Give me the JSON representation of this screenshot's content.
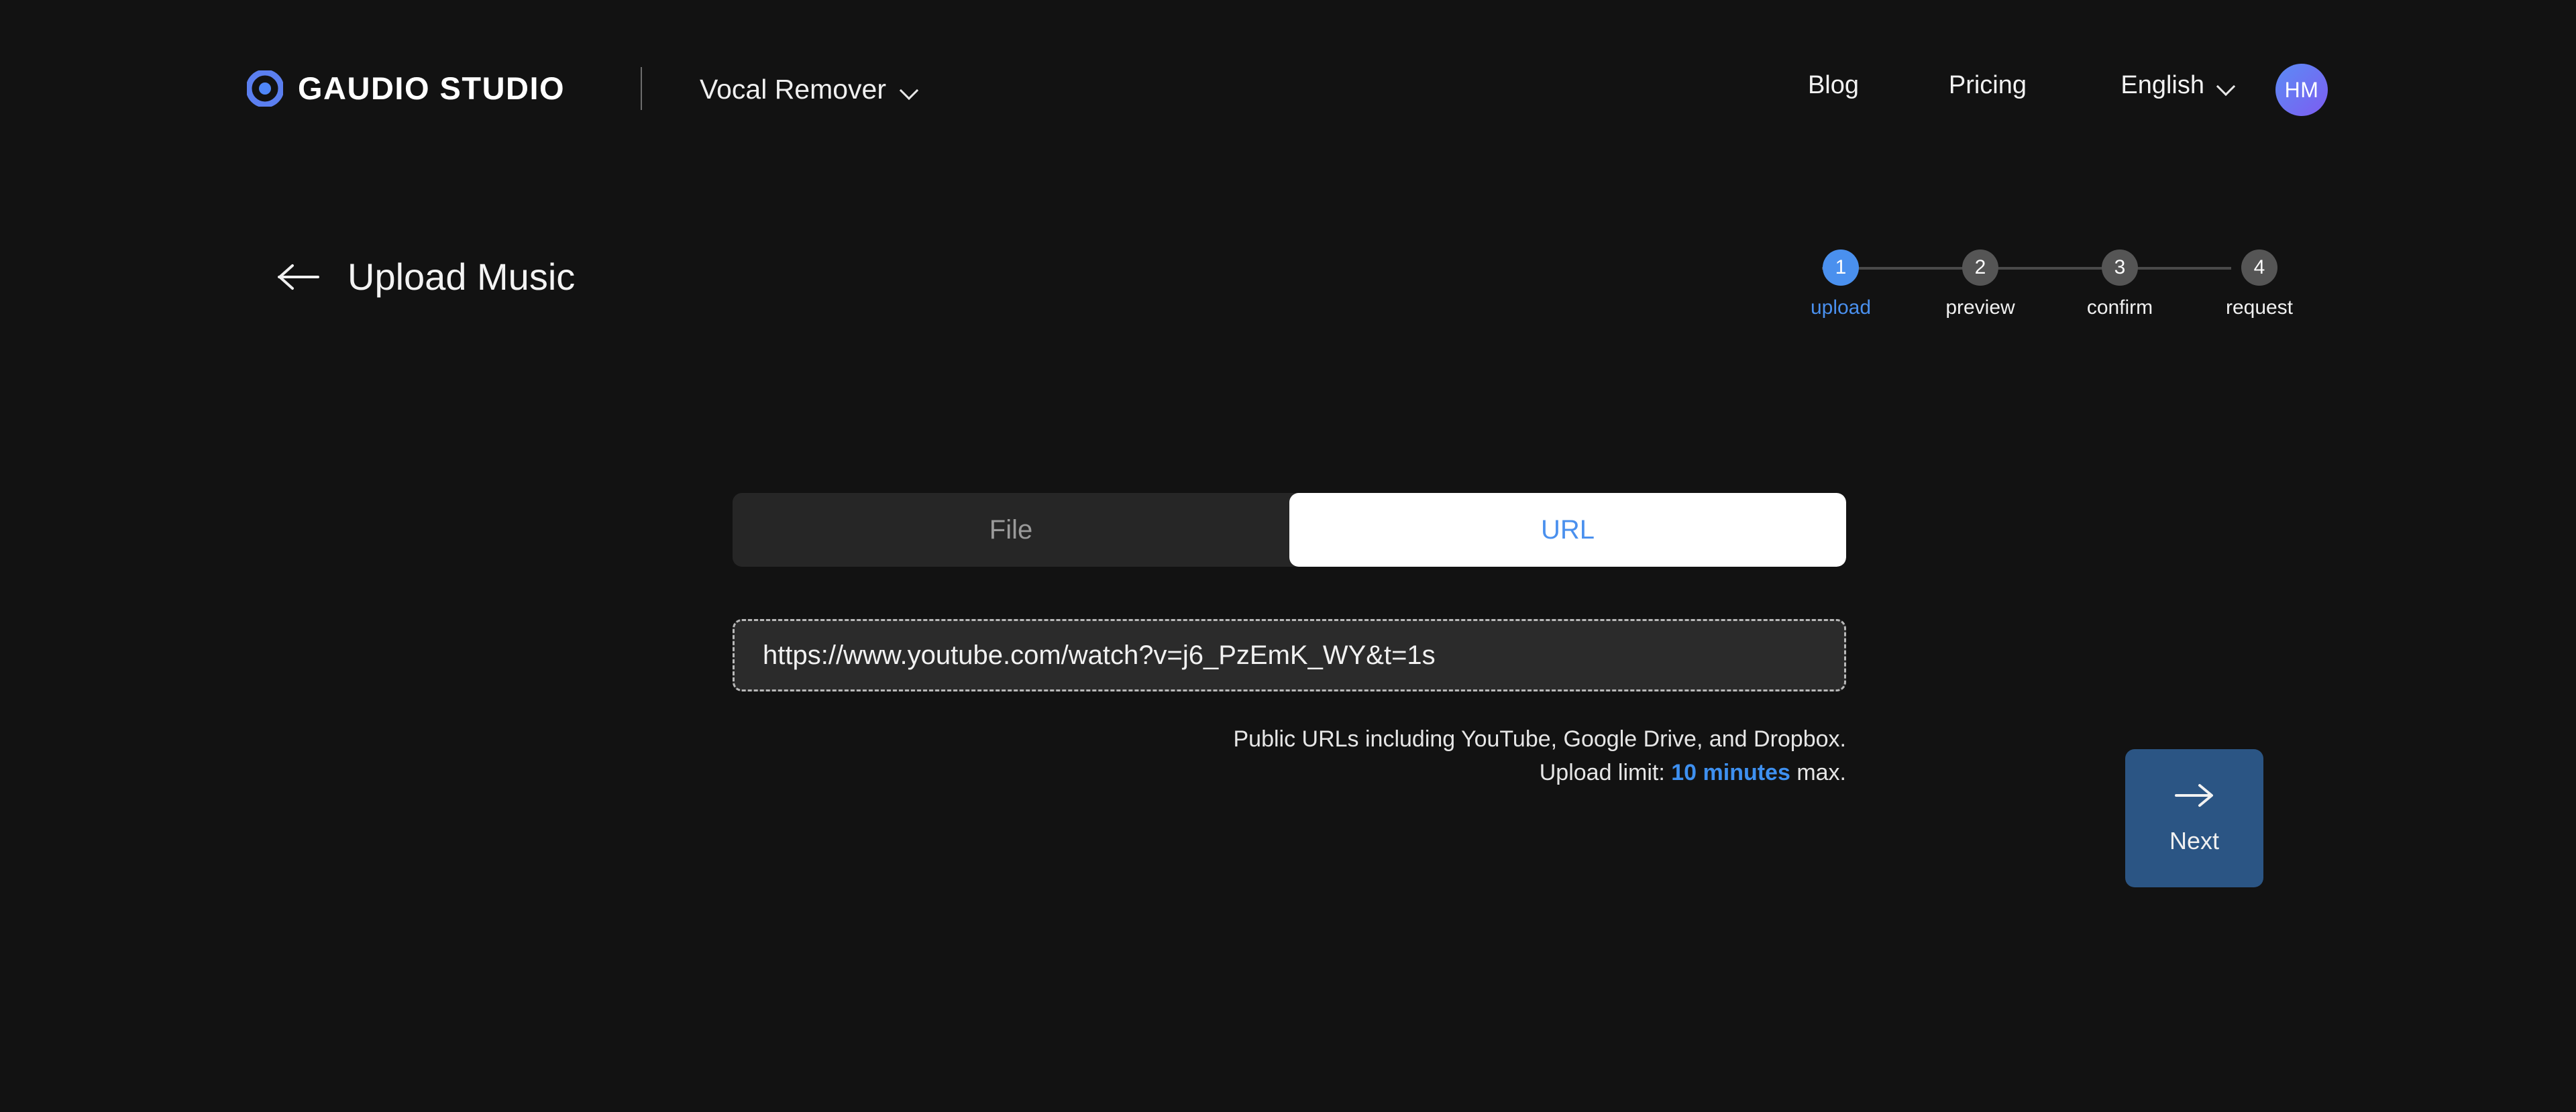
{
  "colors": {
    "background": "#121212",
    "accent_blue": "#4a90ee",
    "helper_accent": "#3e90f0",
    "tab_inactive_bg": "#262626",
    "tab_active_bg": "#ffffff",
    "step_inactive": "#555555",
    "next_button_bg": "#2b5584",
    "avatar_gradient_from": "#5b8cf5",
    "avatar_gradient_to": "#7d5cf0"
  },
  "header": {
    "logo_icon": "gaudio-ring-logo-icon",
    "brand_name": "GAUDIO STUDIO",
    "product": {
      "label": "Vocal Remover",
      "chevron_icon": "chevron-down-icon"
    },
    "nav": {
      "blog": "Blog",
      "pricing": "Pricing",
      "language": "English",
      "language_chevron_icon": "chevron-down-icon"
    },
    "avatar": {
      "initials": "HM"
    }
  },
  "page": {
    "back_icon": "arrow-left-icon",
    "title": "Upload Music"
  },
  "stepper": {
    "steps": [
      {
        "number": "1",
        "label": "upload",
        "active": true
      },
      {
        "number": "2",
        "label": "preview",
        "active": false
      },
      {
        "number": "3",
        "label": "confirm",
        "active": false
      },
      {
        "number": "4",
        "label": "request",
        "active": false
      }
    ]
  },
  "upload": {
    "tabs": [
      {
        "label": "File",
        "active": false
      },
      {
        "label": "URL",
        "active": true
      }
    ],
    "url_input": {
      "value": "https://www.youtube.com/watch?v=j6_PzEmK_WY&t=1s",
      "placeholder": "https://www.youtube.com/watch?v=j6_PzEmK_WY&t=1s"
    },
    "helper": {
      "line1": "Public URLs including YouTube, Google Drive, and Dropbox.",
      "line2_prefix": "Upload limit: ",
      "line2_accent": "10 minutes",
      "line2_suffix": " max."
    }
  },
  "next_button": {
    "label": "Next",
    "icon": "arrow-right-icon"
  }
}
